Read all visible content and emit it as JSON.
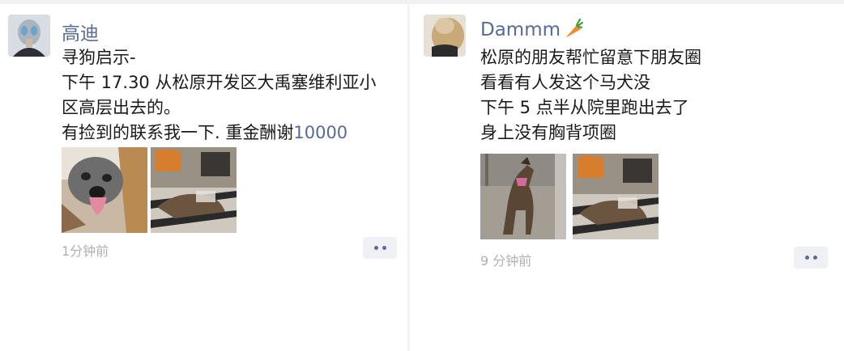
{
  "posts": [
    {
      "author": "高迪",
      "lines": [
        "寻狗启示-",
        "下午 17.30 从松原开发区大禹塞维利亚小",
        "区高层出去的。"
      ],
      "last_line_prefix": "有捡到的联系我一下. 重金酬谢",
      "reward": "10000",
      "time": "1分钟前",
      "images": [
        {
          "name": "dog-face-photo"
        },
        {
          "name": "dog-lying-on-floor-photo"
        }
      ]
    },
    {
      "author": "Dammm",
      "author_emoji_icon": "carrot-icon",
      "lines": [
        "松原的朋友帮忙留意下朋友圈",
        "看看有人发这个马犬没",
        "下午 5 点半从院里跑出去了",
        "身上没有胸背项圈"
      ],
      "time": "9 分钟前",
      "images": [
        {
          "name": "dog-standing-by-tree-photo"
        },
        {
          "name": "dog-lying-on-floor-photo"
        }
      ]
    }
  ],
  "colors": {
    "name_link": "#576b95",
    "text": "#1a1a1a",
    "timestamp": "#b0b0b0",
    "more_button_bg": "#eef0f4"
  }
}
